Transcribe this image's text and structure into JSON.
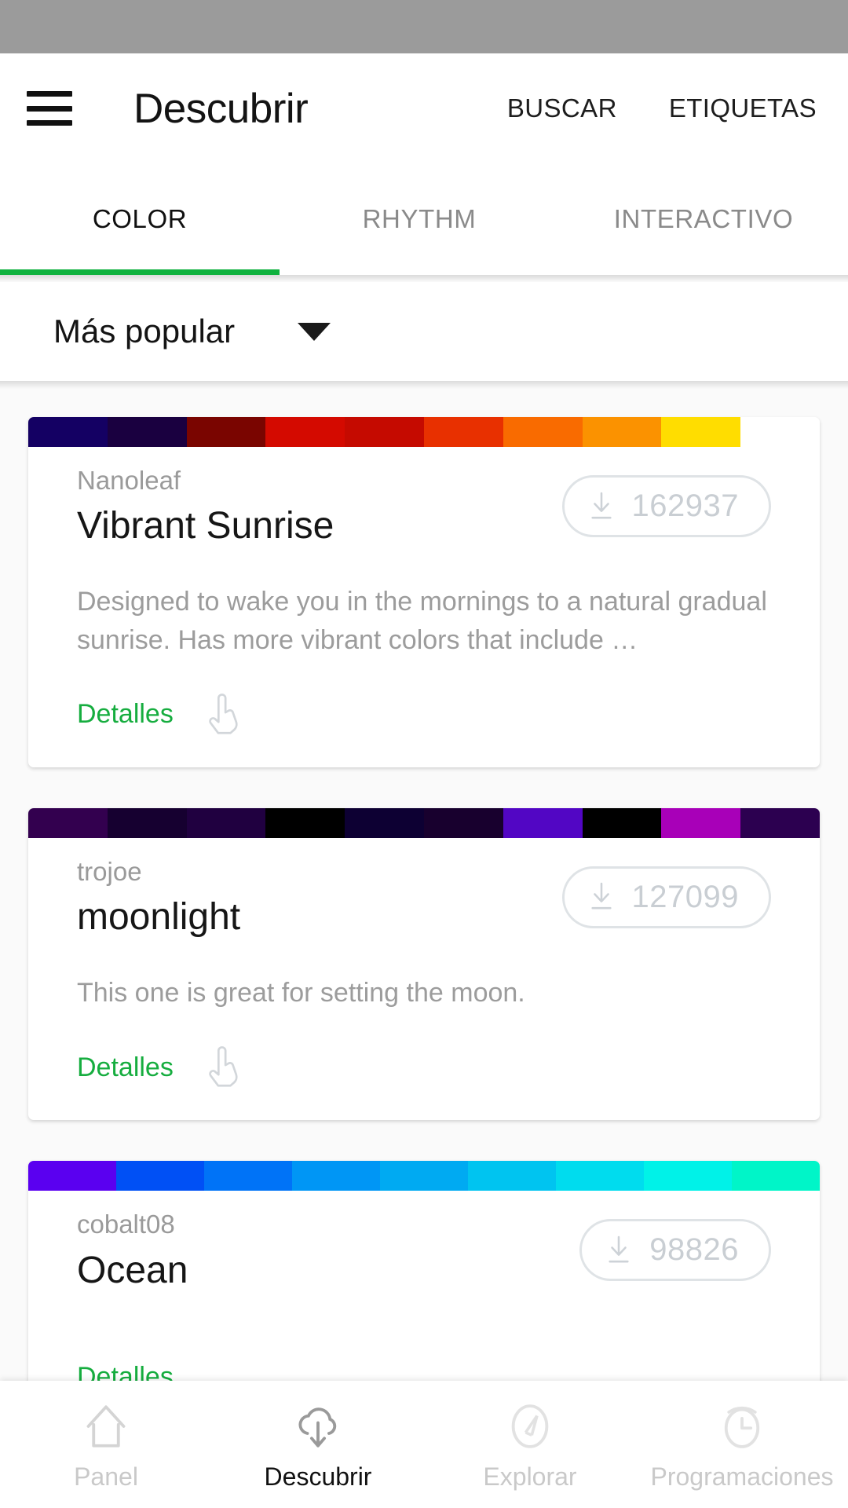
{
  "app": {
    "title": "Descubrir",
    "menu_icon": "hamburger-menu-icon",
    "actions": [
      {
        "label": "BUSCAR",
        "name": "search"
      },
      {
        "label": "ETIQUETAS",
        "name": "tags"
      }
    ]
  },
  "tabs": [
    {
      "label": "COLOR",
      "active": true
    },
    {
      "label": "RHYTHM",
      "active": false
    },
    {
      "label": "INTERACTIVO",
      "active": false
    }
  ],
  "tab_indicator_color": "#10b23f",
  "sort": {
    "label": "Más popular",
    "caret_icon": "chevron-down-icon"
  },
  "details_link_color": "#16ad3f",
  "cards": [
    {
      "author": "Nanoleaf",
      "title": "Vibrant Sunrise",
      "downloads": "162937",
      "download_icon": "download-arrow-icon",
      "description": "Designed to wake you in the mornings to a natural gradual sunrise. Has more vibrant colors that include …",
      "details_label": "Detalles",
      "tap_icon": "hand-tap-icon",
      "palette": [
        "#140063",
        "#1A0040",
        "#7A0500",
        "#D40A00",
        "#C50A00",
        "#E83000",
        "#F96B00",
        "#FB9200",
        "#FFDD00",
        "#FFFFFF"
      ]
    },
    {
      "author": "trojoe",
      "title": "moonlight",
      "downloads": "127099",
      "download_icon": "download-arrow-icon",
      "description": "This one is great for setting the moon.",
      "details_label": "Detalles",
      "tap_icon": "hand-tap-icon",
      "palette": [
        "#33004F",
        "#160030",
        "#200040",
        "#000000",
        "#0D0033",
        "#18002E",
        "#5206C4",
        "#000000",
        "#A800B8",
        "#2C0050"
      ]
    },
    {
      "author": "cobalt08",
      "title": "Ocean",
      "downloads": "98826",
      "download_icon": "download-arrow-icon",
      "description": "",
      "details_label": "Detalles",
      "tap_icon": "hand-tap-icon",
      "palette": [
        "#5A00F0",
        "#0050F5",
        "#0073F7",
        "#0096F5",
        "#00AAF2",
        "#00C4F0",
        "#00DCEE",
        "#00F2E8",
        "#00F5C8"
      ]
    }
  ],
  "bottom_nav": [
    {
      "label": "Panel",
      "icon": "home-icon",
      "active": false
    },
    {
      "label": "Descubrir",
      "icon": "cloud-download-icon",
      "active": true
    },
    {
      "label": "Explorar",
      "icon": "compass-icon",
      "active": false
    },
    {
      "label": "Programaciones",
      "icon": "clock-schedule-icon",
      "active": false
    }
  ]
}
